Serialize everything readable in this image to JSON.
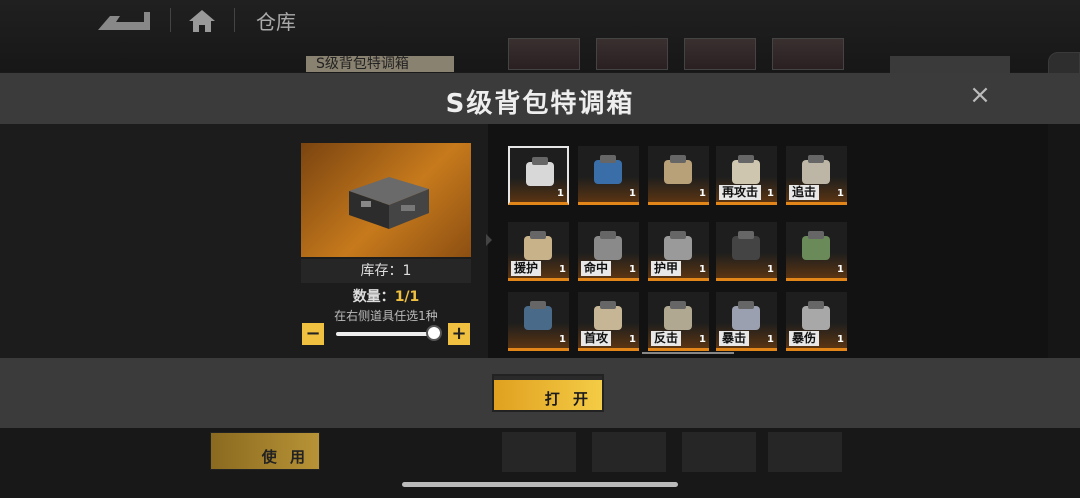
{
  "background": {
    "page_title": "仓库",
    "tag": "S级背包特调箱",
    "use_button": "使 用"
  },
  "modal": {
    "title": "S级背包特调箱",
    "close_icon": "×",
    "stock_label": "库存：1",
    "quantity_label": "数量：",
    "quantity_value": "1/1",
    "hint": "在右侧道具任选1种",
    "minus": "−",
    "plus": "+",
    "slider_fraction": 1.0,
    "open_button": "打 开"
  },
  "items": [
    {
      "label": "",
      "count": "1",
      "selected": true
    },
    {
      "label": "",
      "count": "1"
    },
    {
      "label": "",
      "count": "1"
    },
    {
      "label": "再攻击",
      "count": "1"
    },
    {
      "label": "追击",
      "count": "1"
    },
    {
      "label": "援护",
      "count": "1"
    },
    {
      "label": "命中",
      "count": "1"
    },
    {
      "label": "护甲",
      "count": "1"
    },
    {
      "label": "",
      "count": "1"
    },
    {
      "label": "",
      "count": "1"
    },
    {
      "label": "",
      "count": "1"
    },
    {
      "label": "首攻",
      "count": "1"
    },
    {
      "label": "反击",
      "count": "1"
    },
    {
      "label": "暴击",
      "count": "1"
    },
    {
      "label": "暴伤",
      "count": "1"
    }
  ],
  "colors": {
    "accent": "#f0c040",
    "rarity_orange": "#e2861a"
  },
  "side_tab_icon": "chevron-left-icon"
}
